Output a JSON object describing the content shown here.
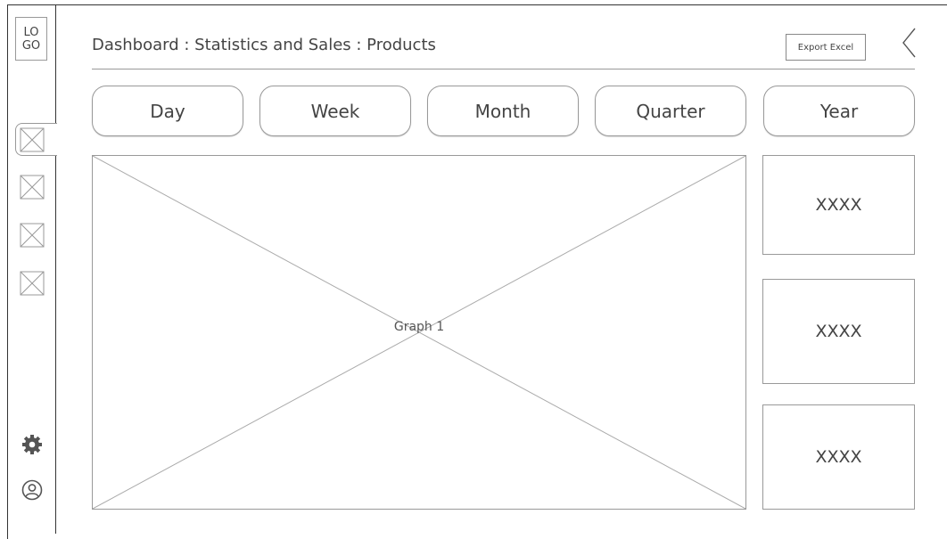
{
  "logo": {
    "line1": "LO",
    "line2": "GO"
  },
  "sidebar": {
    "items": [
      {
        "icon": "image-placeholder-icon",
        "active": true
      },
      {
        "icon": "image-placeholder-icon",
        "active": false
      },
      {
        "icon": "image-placeholder-icon",
        "active": false
      },
      {
        "icon": "image-placeholder-icon",
        "active": false
      }
    ],
    "bottom": [
      {
        "icon": "gear-icon"
      },
      {
        "icon": "user-icon"
      }
    ]
  },
  "header": {
    "breadcrumb": "Dashboard : Statistics and Sales : Products",
    "export_label": "Export Excel",
    "back_icon": "chevron-left-icon"
  },
  "tabs": [
    {
      "label": "Day"
    },
    {
      "label": "Week"
    },
    {
      "label": "Month"
    },
    {
      "label": "Quarter"
    },
    {
      "label": "Year"
    }
  ],
  "graph": {
    "label": "Graph 1"
  },
  "stats": [
    {
      "value": "XXXX"
    },
    {
      "value": "XXXX"
    },
    {
      "value": "XXXX"
    }
  ],
  "colors": {
    "line": "#999999",
    "text": "#444444",
    "frame": "#333333"
  }
}
